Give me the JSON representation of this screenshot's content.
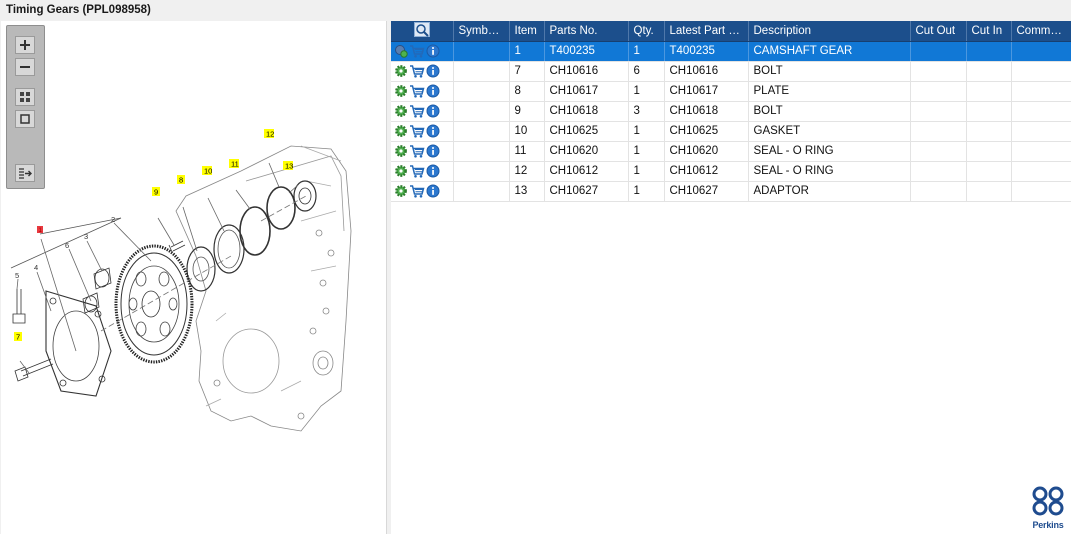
{
  "window": {
    "title": "Timing Gears (PPL098958)"
  },
  "diagram": {
    "callouts": [
      "12",
      "11",
      "13",
      "10",
      "8",
      "9",
      "7"
    ],
    "plain_labels": [
      "1",
      "2",
      "3",
      "6",
      "4",
      "5"
    ],
    "highlight_color": "#ffff00",
    "selected_color": "#e8393f"
  },
  "zoom_toolbar": {
    "buttons": [
      "zoom-in-icon",
      "zoom-out-icon",
      "fit-all-icon",
      "actual-size-icon",
      "export-icon"
    ]
  },
  "grid": {
    "header_color": "#1c4f8c",
    "selected_color": "#1178d6",
    "columns": [
      "Symbol...",
      "Item",
      "Parts No.",
      "Qty.",
      "Latest Part No.",
      "Description",
      "Cut Out",
      "Cut In",
      "Comment"
    ],
    "rows": [
      {
        "item": "1",
        "parts_no": "T400235",
        "qty": "1",
        "latest": "T400235",
        "description": "CAMSHAFT GEAR",
        "cut_out": "",
        "cut_in": "",
        "comment": "",
        "selected": true
      },
      {
        "item": "7",
        "parts_no": "CH10616",
        "qty": "6",
        "latest": "CH10616",
        "description": "BOLT",
        "cut_out": "",
        "cut_in": "",
        "comment": "",
        "selected": false
      },
      {
        "item": "8",
        "parts_no": "CH10617",
        "qty": "1",
        "latest": "CH10617",
        "description": "PLATE",
        "cut_out": "",
        "cut_in": "",
        "comment": "",
        "selected": false
      },
      {
        "item": "9",
        "parts_no": "CH10618",
        "qty": "3",
        "latest": "CH10618",
        "description": "BOLT",
        "cut_out": "",
        "cut_in": "",
        "comment": "",
        "selected": false
      },
      {
        "item": "10",
        "parts_no": "CH10625",
        "qty": "1",
        "latest": "CH10625",
        "description": "GASKET",
        "cut_out": "",
        "cut_in": "",
        "comment": "",
        "selected": false
      },
      {
        "item": "11",
        "parts_no": "CH10620",
        "qty": "1",
        "latest": "CH10620",
        "description": "SEAL - O RING",
        "cut_out": "",
        "cut_in": "",
        "comment": "",
        "selected": false
      },
      {
        "item": "12",
        "parts_no": "CH10612",
        "qty": "1",
        "latest": "CH10612",
        "description": "SEAL - O RING",
        "cut_out": "",
        "cut_in": "",
        "comment": "",
        "selected": false
      },
      {
        "item": "13",
        "parts_no": "CH10627",
        "qty": "1",
        "latest": "CH10627",
        "description": "ADAPTOR",
        "cut_out": "",
        "cut_in": "",
        "comment": "",
        "selected": false
      }
    ]
  },
  "brand": {
    "name": "Perkins",
    "color": "#1f4c8f"
  }
}
